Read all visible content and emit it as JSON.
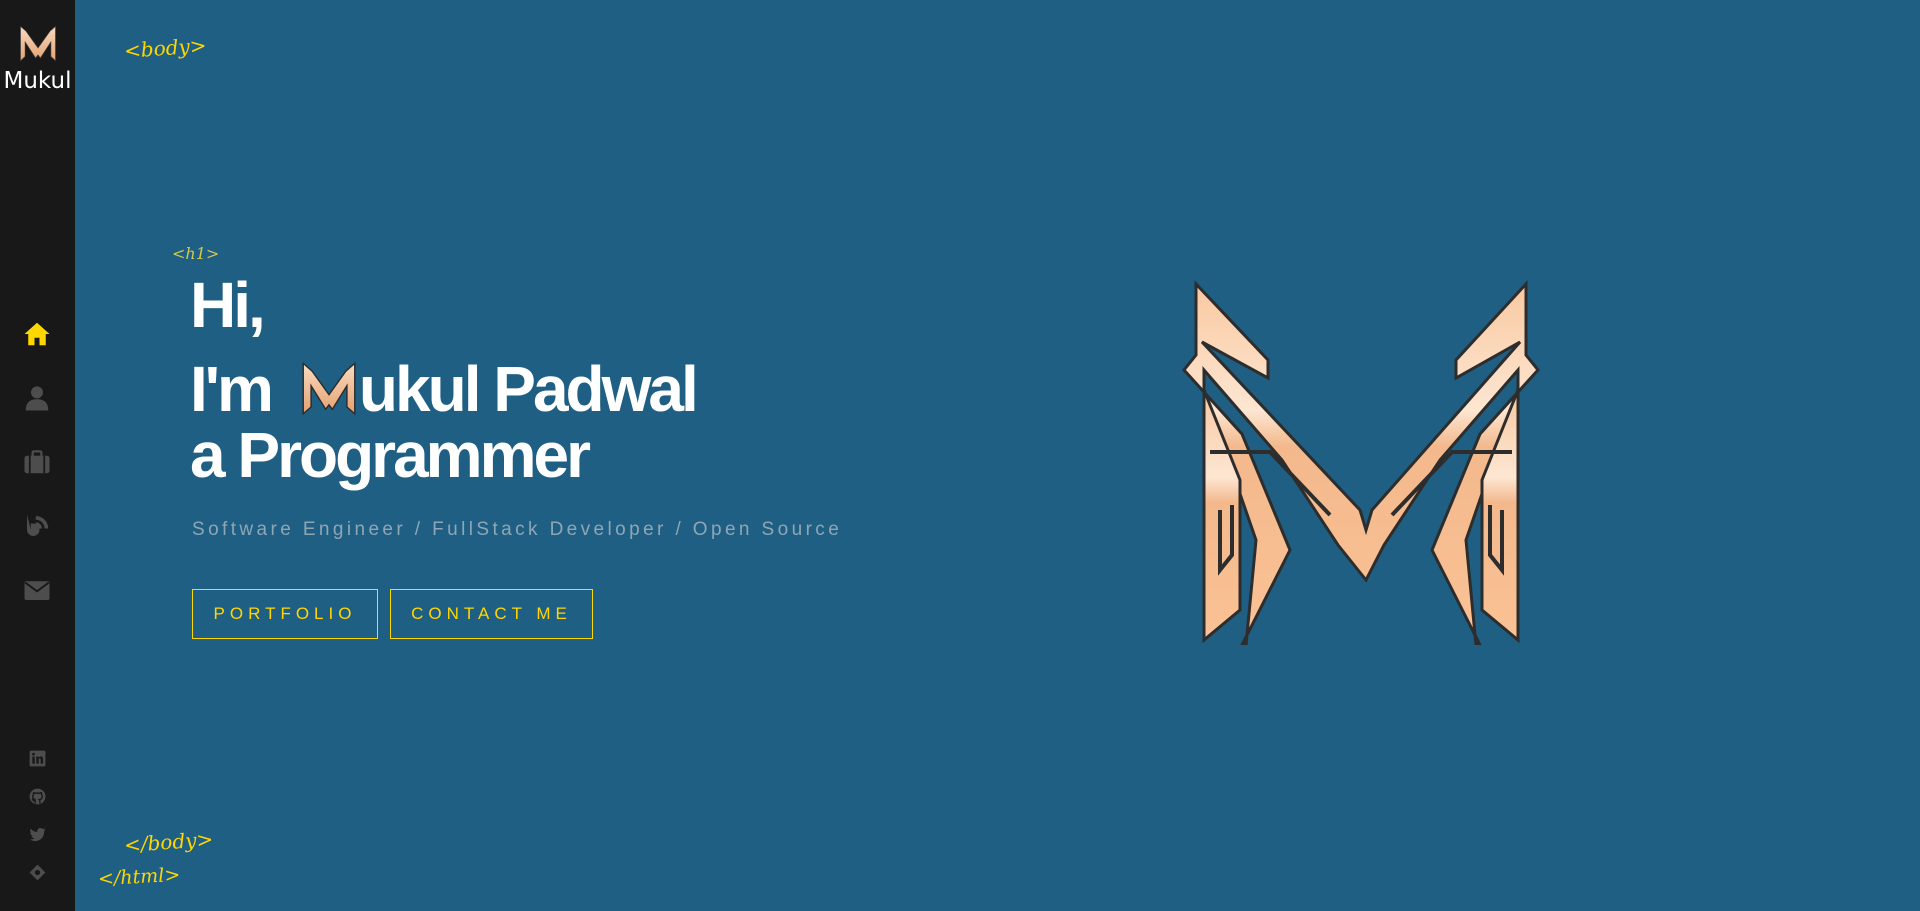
{
  "sidebar": {
    "logo_text": "Mukul",
    "nav": [
      {
        "name": "home",
        "icon": "home-icon",
        "active": true
      },
      {
        "name": "about",
        "icon": "user-icon",
        "active": false
      },
      {
        "name": "portfolio",
        "icon": "briefcase-icon",
        "active": false
      },
      {
        "name": "blog",
        "icon": "blog-icon",
        "active": false
      },
      {
        "name": "contact",
        "icon": "envelope-icon",
        "active": false
      }
    ],
    "social": [
      {
        "name": "linkedin",
        "icon": "linkedin-icon"
      },
      {
        "name": "github",
        "icon": "github-icon"
      },
      {
        "name": "twitter",
        "icon": "twitter-icon"
      },
      {
        "name": "other",
        "icon": "diamond-icon"
      }
    ]
  },
  "tags": {
    "body_open": "<body>",
    "h1": "<h1>",
    "body_close": "</body>",
    "html_close": "</html>"
  },
  "hero": {
    "line1": "Hi,",
    "line2_prefix": "I'm",
    "line2_name": "ukul Padwal",
    "line3": "a Programmer",
    "subtitle": "Software Engineer / FullStack Developer / Open Source"
  },
  "buttons": {
    "portfolio": "PORTFOLIO",
    "contact": "CONTACT ME"
  },
  "colors": {
    "background": "#1f5f83",
    "sidebar": "#181818",
    "accent": "#ffd700",
    "nav_inactive": "#4d4d4e",
    "logo_gradient": [
      "#f7dcc0",
      "#e7a071"
    ]
  }
}
